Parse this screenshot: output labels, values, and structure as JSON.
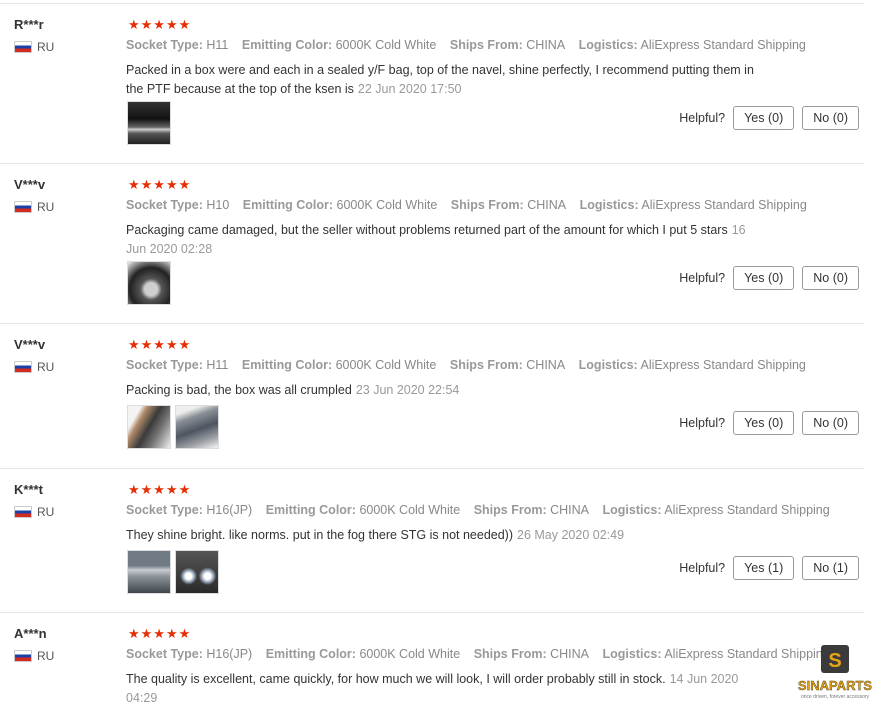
{
  "helpful_label": "Helpful?",
  "attr_keys": {
    "socket": "Socket Type:",
    "color": "Emitting Color:",
    "ships": "Ships From:",
    "logistics": "Logistics:"
  },
  "reviews": [
    {
      "user": "R***r",
      "country": "RU",
      "rating": 5,
      "socket": "H11",
      "color": "6000K Cold White",
      "ships": "CHINA",
      "logistics": "AliExpress Standard Shipping",
      "text": "Packed in a box were and each in a sealed y/F bag, top of the navel, shine perfectly, I recommend putting them in the PTF because at the top of the ksen is",
      "date": "22 Jun 2020 17:50",
      "yes": "Yes (0)",
      "no": "No (0)"
    },
    {
      "user": "V***v",
      "country": "RU",
      "rating": 5,
      "socket": "H10",
      "color": "6000K Cold White",
      "ships": "CHINA",
      "logistics": "AliExpress Standard Shipping",
      "text": "Packaging came damaged, but the seller without problems returned part of the amount for which I put 5 stars",
      "date": "16 Jun 2020 02:28",
      "yes": "Yes (0)",
      "no": "No (0)"
    },
    {
      "user": "V***v",
      "country": "RU",
      "rating": 5,
      "socket": "H11",
      "color": "6000K Cold White",
      "ships": "CHINA",
      "logistics": "AliExpress Standard Shipping",
      "text": "Packing is bad, the box was all crumpled",
      "date": "23 Jun 2020 22:54",
      "yes": "Yes (0)",
      "no": "No (0)"
    },
    {
      "user": "K***t",
      "country": "RU",
      "rating": 5,
      "socket": "H16(JP)",
      "color": "6000K Cold White",
      "ships": "CHINA",
      "logistics": "AliExpress Standard Shipping",
      "text": "They shine bright. like norms. put in the fog there STG is not needed))",
      "date": "26 May 2020 02:49",
      "yes": "Yes (1)",
      "no": "No (1)"
    },
    {
      "user": "A***n",
      "country": "RU",
      "rating": 5,
      "socket": "H16(JP)",
      "color": "6000K Cold White",
      "ships": "CHINA",
      "logistics": "AliExpress Standard Shipping",
      "text": "The quality is excellent, came quickly, for how much we will look, I will order probably still in stock.",
      "date": "14 Jun 2020 04:29"
    }
  ],
  "star_glyph": "★★★★★",
  "watermark": {
    "brand": "SINAPARTS",
    "tagline": "once driven, forever accessory"
  }
}
